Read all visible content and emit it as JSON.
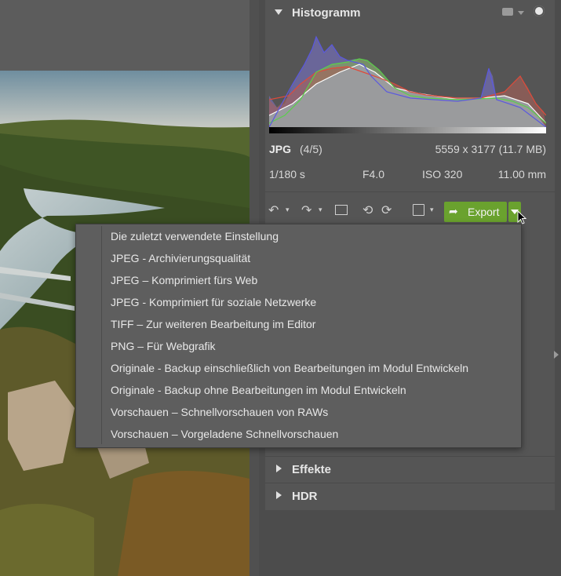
{
  "histogram": {
    "title": "Histogramm",
    "icons": [
      "camera-icon",
      "chevron-down-icon",
      "gear-icon"
    ]
  },
  "file_info": {
    "format": "JPG",
    "index": "(4/5)",
    "dimensions": "5559 x 3177 (11.7 MB)",
    "shutter": "1/180 s",
    "aperture": "F4.0",
    "iso": "ISO 320",
    "focal_length": "11.00 mm"
  },
  "toolbar": {
    "export_label": "Export"
  },
  "export_menu": {
    "items": [
      "Die zuletzt verwendete Einstellung",
      "JPEG - Archivierungsqualität",
      "JPEG – Komprimiert fürs Web",
      "JPEG - Komprimiert für soziale Netzwerke",
      "TIFF – Zur weiteren Bearbeitung im Editor",
      "PNG – Für Webgrafik",
      "Originale - Backup einschließlich von Bearbeitungen im Modul Entwickeln",
      "Originale - Backup ohne Bearbeitungen im Modul Entwickeln",
      "Vorschauen – Schnellvorschauen von RAWs",
      "Vorschauen – Vorgeladene Schnellvorschauen"
    ]
  },
  "sections": {
    "effekte": "Effekte",
    "hdr": "HDR"
  },
  "colors": {
    "export_green": "#6aa22e",
    "panel_bg": "#555555"
  }
}
